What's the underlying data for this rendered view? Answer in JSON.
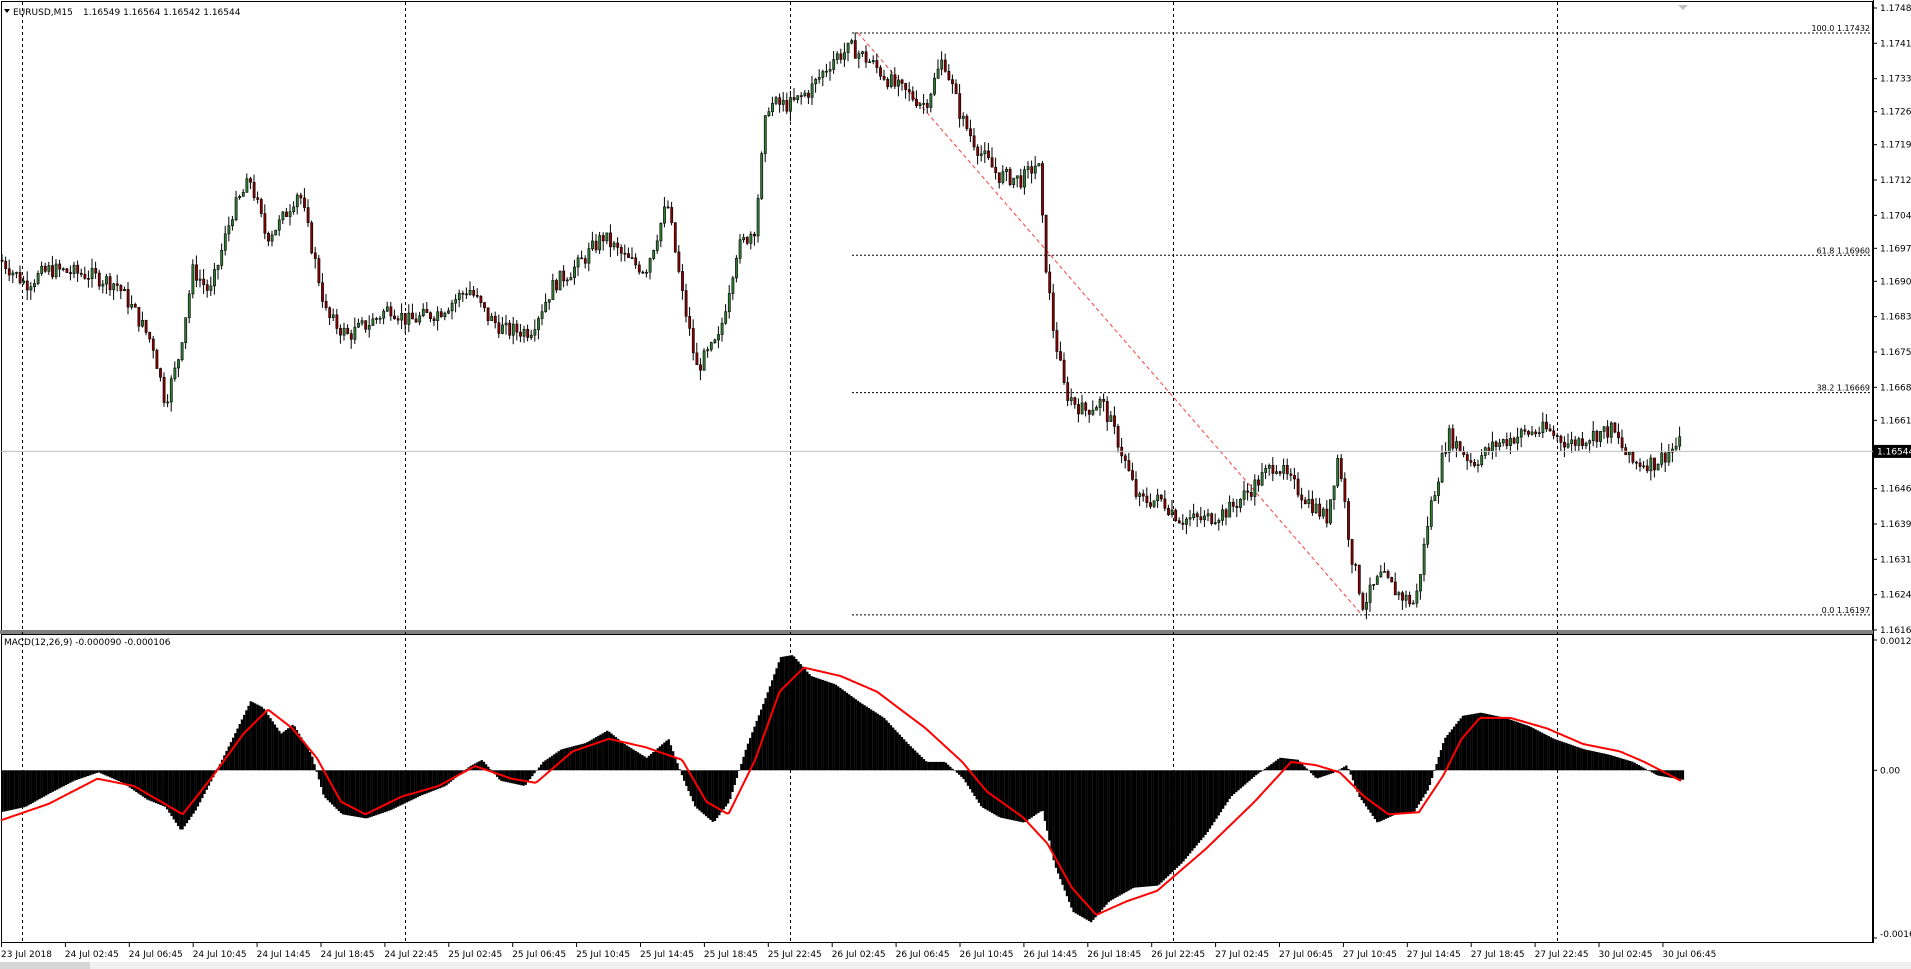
{
  "main_panel": {
    "symbol_label": "EURUSD,M15",
    "ohlc_label": "1.16549 1.16564 1.16542 1.16544",
    "current_price_label": "1.16544",
    "price_axis": [
      "1.17485",
      "1.17410",
      "1.17335",
      "1.17265",
      "1.17195",
      "1.17120",
      "1.17045",
      "1.16975",
      "1.16905",
      "1.16830",
      "1.16755",
      "1.16680",
      "1.16610",
      "1.16465",
      "1.16390",
      "1.16315",
      "1.16240",
      "1.16165"
    ],
    "fib_levels": [
      {
        "label": "100.0 1.17432"
      },
      {
        "label": "61.8 1.16960"
      },
      {
        "label": "38.2 1.16669"
      },
      {
        "label": "0.0 1.16197"
      }
    ]
  },
  "macd_panel": {
    "indicator_label": "MACD(12,26,9) -0.000090 -0.000106",
    "axis": [
      "0.001243",
      "0.00",
      "-0.00160"
    ]
  },
  "time_axis": [
    "23 Jul 2018",
    "24 Jul 02:45",
    "24 Jul 06:45",
    "24 Jul 10:45",
    "24 Jul 14:45",
    "24 Jul 18:45",
    "24 Jul 22:45",
    "25 Jul 02:45",
    "25 Jul 06:45",
    "25 Jul 10:45",
    "25 Jul 14:45",
    "25 Jul 18:45",
    "25 Jul 22:45",
    "26 Jul 02:45",
    "26 Jul 06:45",
    "26 Jul 10:45",
    "26 Jul 14:45",
    "26 Jul 18:45",
    "26 Jul 22:45",
    "27 Jul 02:45",
    "27 Jul 06:45",
    "27 Jul 10:45",
    "27 Jul 14:45",
    "27 Jul 18:45",
    "27 Jul 22:45",
    "30 Jul 02:45",
    "30 Jul 06:45"
  ],
  "colors": {
    "background": "#ffffff",
    "candles": "#000000",
    "bull_accent": "#2e7d32",
    "bear_accent": "#8b0000",
    "signal_line": "#ff0000",
    "fib_retracement": "#ff4040",
    "grid": "#000000"
  },
  "chart_data": [
    {
      "type": "candlestick",
      "title": "EURUSD,M15",
      "ylim": [
        1.16165,
        1.17485
      ],
      "price_path_keypoints": [
        [
          0,
          1.1695
        ],
        [
          20,
          1.169
        ],
        [
          40,
          1.1693
        ],
        [
          70,
          1.1692
        ],
        [
          95,
          1.169
        ],
        [
          110,
          1.1684
        ],
        [
          125,
          1.1677
        ],
        [
          135,
          1.1665
        ],
        [
          145,
          1.1673
        ],
        [
          158,
          1.1693
        ],
        [
          172,
          1.1688
        ],
        [
          190,
          1.1705
        ],
        [
          205,
          1.1712
        ],
        [
          218,
          1.17
        ],
        [
          230,
          1.1703
        ],
        [
          245,
          1.171
        ],
        [
          258,
          1.1695
        ],
        [
          268,
          1.1683
        ],
        [
          285,
          1.1679
        ],
        [
          305,
          1.1682
        ],
        [
          320,
          1.1685
        ],
        [
          335,
          1.1682
        ],
        [
          360,
          1.1684
        ],
        [
          385,
          1.1689
        ],
        [
          400,
          1.1683
        ],
        [
          415,
          1.168
        ],
        [
          435,
          1.168
        ],
        [
          455,
          1.169
        ],
        [
          475,
          1.1694
        ],
        [
          495,
          1.17
        ],
        [
          515,
          1.1695
        ],
        [
          530,
          1.1693
        ],
        [
          548,
          1.1707
        ],
        [
          560,
          1.1688
        ],
        [
          572,
          1.1672
        ],
        [
          590,
          1.1678
        ],
        [
          605,
          1.1697
        ],
        [
          620,
          1.1702
        ],
        [
          630,
          1.1728
        ],
        [
          650,
          1.1728
        ],
        [
          665,
          1.1731
        ],
        [
          685,
          1.1738
        ],
        [
          700,
          1.174
        ],
        [
          715,
          1.1737
        ],
        [
          735,
          1.1732
        ],
        [
          760,
          1.1728
        ],
        [
          775,
          1.1738
        ],
        [
          790,
          1.1725
        ],
        [
          805,
          1.1718
        ],
        [
          820,
          1.1713
        ],
        [
          840,
          1.1712
        ],
        [
          853,
          1.1716
        ],
        [
          858,
          1.1697
        ],
        [
          865,
          1.1681
        ],
        [
          875,
          1.1667
        ],
        [
          890,
          1.1663
        ],
        [
          905,
          1.1665
        ],
        [
          918,
          1.1657
        ],
        [
          935,
          1.1644
        ],
        [
          955,
          1.1644
        ],
        [
          970,
          1.164
        ],
        [
          990,
          1.164
        ],
        [
          1010,
          1.1642
        ],
        [
          1030,
          1.1647
        ],
        [
          1048,
          1.1652
        ],
        [
          1060,
          1.1648
        ],
        [
          1075,
          1.1644
        ],
        [
          1090,
          1.164
        ],
        [
          1100,
          1.1654
        ],
        [
          1110,
          1.1633
        ],
        [
          1120,
          1.1622
        ],
        [
          1135,
          1.1628
        ],
        [
          1150,
          1.1624
        ],
        [
          1163,
          1.1622
        ],
        [
          1175,
          1.1642
        ],
        [
          1190,
          1.1658
        ],
        [
          1210,
          1.1652
        ],
        [
          1230,
          1.1656
        ],
        [
          1250,
          1.1658
        ],
        [
          1270,
          1.1659
        ],
        [
          1290,
          1.1656
        ],
        [
          1310,
          1.1658
        ],
        [
          1325,
          1.1659
        ],
        [
          1340,
          1.1652
        ],
        [
          1360,
          1.1652
        ],
        [
          1380,
          1.1656
        ]
      ],
      "fibonacci": {
        "high": 1.17432,
        "low": 1.16197,
        "levels": [
          100.0,
          61.8,
          38.2,
          0.0
        ]
      },
      "last_price": 1.16544
    },
    {
      "type": "bar",
      "title": "MACD(12,26,9)",
      "ylim": [
        -0.0016,
        0.001243
      ],
      "histogram_keypoints": [
        [
          0,
          -0.0004
        ],
        [
          20,
          -0.00035
        ],
        [
          40,
          -0.00022
        ],
        [
          60,
          -0.0001
        ],
        [
          80,
          -2e-05
        ],
        [
          100,
          -0.00012
        ],
        [
          120,
          -0.00028
        ],
        [
          135,
          -0.00035
        ],
        [
          148,
          -0.00058
        ],
        [
          160,
          -0.00038
        ],
        [
          175,
          -5e-05
        ],
        [
          190,
          0.0003
        ],
        [
          205,
          0.00066
        ],
        [
          215,
          0.0006
        ],
        [
          230,
          0.00035
        ],
        [
          240,
          0.00044
        ],
        [
          255,
          0.00015
        ],
        [
          265,
          -0.00025
        ],
        [
          280,
          -0.00042
        ],
        [
          300,
          -0.00046
        ],
        [
          320,
          -0.00038
        ],
        [
          345,
          -0.00024
        ],
        [
          365,
          -0.00015
        ],
        [
          385,
          4e-05
        ],
        [
          395,
          0.0001
        ],
        [
          410,
          -0.0001
        ],
        [
          430,
          -0.00015
        ],
        [
          445,
          8e-05
        ],
        [
          460,
          0.0002
        ],
        [
          480,
          0.00026
        ],
        [
          498,
          0.00038
        ],
        [
          512,
          0.00025
        ],
        [
          530,
          0.00012
        ],
        [
          548,
          0.0003
        ],
        [
          560,
          -8e-05
        ],
        [
          570,
          -0.00035
        ],
        [
          585,
          -0.0005
        ],
        [
          598,
          -0.0003
        ],
        [
          612,
          0.00022
        ],
        [
          628,
          0.0007
        ],
        [
          640,
          0.00108
        ],
        [
          650,
          0.0011
        ],
        [
          665,
          0.0009
        ],
        [
          685,
          0.00082
        ],
        [
          705,
          0.00065
        ],
        [
          725,
          0.0005
        ],
        [
          745,
          0.00025
        ],
        [
          760,
          8e-05
        ],
        [
          775,
          8e-05
        ],
        [
          790,
          -8e-05
        ],
        [
          805,
          -0.00035
        ],
        [
          820,
          -0.00045
        ],
        [
          840,
          -0.0005
        ],
        [
          855,
          -0.00038
        ],
        [
          865,
          -0.0009
        ],
        [
          880,
          -0.00135
        ],
        [
          895,
          -0.00145
        ],
        [
          910,
          -0.00125
        ],
        [
          930,
          -0.00112
        ],
        [
          950,
          -0.0011
        ],
        [
          970,
          -0.00088
        ],
        [
          990,
          -0.0006
        ],
        [
          1010,
          -0.00025
        ],
        [
          1030,
          -5e-05
        ],
        [
          1050,
          0.00012
        ],
        [
          1065,
          0.0001
        ],
        [
          1080,
          -8e-05
        ],
        [
          1095,
          -2e-05
        ],
        [
          1105,
          5e-05
        ],
        [
          1115,
          -0.00025
        ],
        [
          1130,
          -0.0005
        ],
        [
          1145,
          -0.00042
        ],
        [
          1160,
          -0.0004
        ],
        [
          1172,
          -0.00018
        ],
        [
          1185,
          0.0003
        ],
        [
          1200,
          0.00052
        ],
        [
          1215,
          0.00055
        ],
        [
          1235,
          0.0005
        ],
        [
          1255,
          0.00042
        ],
        [
          1275,
          0.0003
        ],
        [
          1300,
          0.0002
        ],
        [
          1320,
          0.00015
        ],
        [
          1340,
          8e-05
        ],
        [
          1360,
          -5e-05
        ],
        [
          1380,
          -9e-05
        ]
      ],
      "signal_keypoints": [
        [
          0,
          -0.00048
        ],
        [
          40,
          -0.00032
        ],
        [
          80,
          -8e-05
        ],
        [
          110,
          -0.00015
        ],
        [
          150,
          -0.00042
        ],
        [
          175,
          -5e-05
        ],
        [
          200,
          0.00035
        ],
        [
          220,
          0.00058
        ],
        [
          240,
          0.0004
        ],
        [
          260,
          0.00012
        ],
        [
          280,
          -0.0003
        ],
        [
          300,
          -0.00042
        ],
        [
          330,
          -0.00025
        ],
        [
          360,
          -0.00015
        ],
        [
          390,
          4e-05
        ],
        [
          420,
          -8e-05
        ],
        [
          440,
          -0.00012
        ],
        [
          470,
          0.00018
        ],
        [
          500,
          0.0003
        ],
        [
          530,
          0.00022
        ],
        [
          560,
          0.0001
        ],
        [
          580,
          -0.0003
        ],
        [
          598,
          -0.00042
        ],
        [
          620,
          0.0001
        ],
        [
          640,
          0.00075
        ],
        [
          660,
          0.00098
        ],
        [
          690,
          0.0009
        ],
        [
          720,
          0.00075
        ],
        [
          760,
          0.0004
        ],
        [
          790,
          8e-05
        ],
        [
          810,
          -0.0002
        ],
        [
          840,
          -0.00045
        ],
        [
          860,
          -0.0007
        ],
        [
          880,
          -0.00112
        ],
        [
          900,
          -0.00138
        ],
        [
          925,
          -0.00125
        ],
        [
          950,
          -0.00115
        ],
        [
          990,
          -0.00075
        ],
        [
          1030,
          -0.0003
        ],
        [
          1060,
          8e-05
        ],
        [
          1080,
          5e-05
        ],
        [
          1100,
          -2e-05
        ],
        [
          1120,
          -0.00025
        ],
        [
          1140,
          -0.00042
        ],
        [
          1165,
          -0.0004
        ],
        [
          1185,
          -5e-05
        ],
        [
          1200,
          0.0003
        ],
        [
          1215,
          0.0005
        ],
        [
          1240,
          0.0005
        ],
        [
          1270,
          0.0004
        ],
        [
          1300,
          0.00025
        ],
        [
          1330,
          0.00018
        ],
        [
          1350,
          8e-05
        ],
        [
          1380,
          -0.0001
        ]
      ]
    }
  ]
}
